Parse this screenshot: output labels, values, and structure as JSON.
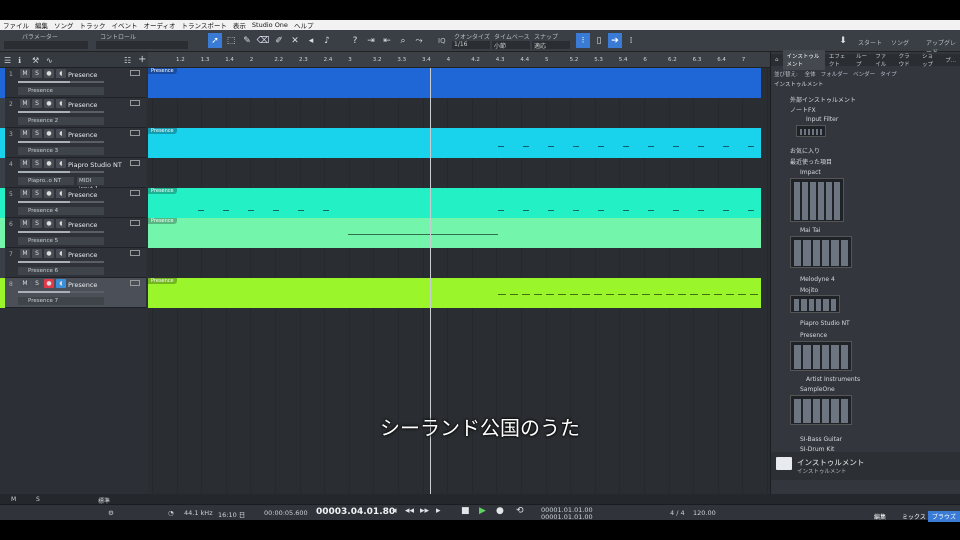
{
  "menu": [
    "ファイル",
    "編集",
    "ソング",
    "トラック",
    "イベント",
    "オーディオ",
    "トランスポート",
    "表示",
    "Studio One",
    "ヘルプ"
  ],
  "toolbar": {
    "param_label": "パラメーター",
    "control_label": "コントロール",
    "iq_label": "IQ",
    "quantize_label": "クオンタイズ",
    "quantize_value": "1/16",
    "timebase_label": "タイムベース",
    "timebase_value": "小節",
    "snap_label": "スナップ",
    "snap_value": "適応",
    "start_label": "スタート",
    "song_label": "ソング",
    "upgrade_label": "アップグレード"
  },
  "ruler": [
    "1.2",
    "1.3",
    "1.4",
    "2",
    "2.2",
    "2.3",
    "2.4",
    "3",
    "3.2",
    "3.3",
    "3.4",
    "4",
    "4.2",
    "4.3",
    "4.4",
    "5",
    "5.2",
    "5.3",
    "5.4",
    "6",
    "6.2",
    "6.3",
    "6.4",
    "7"
  ],
  "tracks": [
    {
      "num": "1",
      "name": "Presence",
      "instrument": "Presence",
      "color": "#1f66d6",
      "clip": true,
      "armed": false
    },
    {
      "num": "2",
      "name": "Presence",
      "instrument": "Presence 2",
      "color": "#2a2d31",
      "clip": false,
      "armed": false
    },
    {
      "num": "3",
      "name": "Presence",
      "instrument": "Presence 3",
      "color": "#19d3ec",
      "clip": true,
      "armed": false
    },
    {
      "num": "4",
      "name": "Piapro Studio NT",
      "instrument": "Piapro..o NT",
      "instrument2": "MIDI input 1",
      "color": "#2a2d31",
      "clip": false,
      "armed": false
    },
    {
      "num": "5",
      "name": "Presence",
      "instrument": "Presence 4",
      "color": "#24f0c6",
      "clip": true,
      "armed": false
    },
    {
      "num": "6",
      "name": "Presence",
      "instrument": "Presence 5",
      "color": "#74f5ac",
      "clip": true,
      "armed": false
    },
    {
      "num": "7",
      "name": "Presence",
      "instrument": "Presence 6",
      "color": "#2a2d31",
      "clip": false,
      "armed": false
    },
    {
      "num": "8",
      "name": "Presence",
      "instrument": "Presence 7",
      "color": "#9af52a",
      "clip": true,
      "armed": true
    }
  ],
  "track_btns": {
    "mute": "M",
    "solo": "S"
  },
  "clip_label": "Presence",
  "browser": {
    "tabs": [
      "インストゥルメント",
      "エフェクト",
      "ループ",
      "ファイル",
      "クラウド",
      "ショップ",
      "プ..."
    ],
    "sortby": "並び替え:",
    "sort_opts": [
      "全体",
      "フォルダー",
      "ベンダー",
      "タイプ"
    ],
    "crumb": "インストゥルメント",
    "items": [
      "外部インストゥルメント",
      "ノートFX",
      "Input Filter",
      "お気に入り",
      "最近使った項目",
      "Impact",
      "Mai Tai",
      "Melodyne 4",
      "Mojito",
      "Piapro Studio NT",
      "Presence",
      "Artist Instruments",
      "SampleOne",
      "SI-Bass Guitar",
      "SI-Drum Kit"
    ],
    "footer_title": "インストゥルメント",
    "footer_sub": "インストゥルメント"
  },
  "status": {
    "m": "M",
    "s": "S",
    "std": "標準"
  },
  "transport": {
    "samplerate": "44.1 kHz",
    "rec_time": "16:10 日",
    "time": "00:00:05.600",
    "position": "00003.04.01.80",
    "loop_start": "00001.01.01.00",
    "loop_end": "00001.01.01.00",
    "signature": "4 / 4",
    "tempo": "120.00"
  },
  "bottom_tabs": [
    "編集",
    "ミックス",
    "ブラウズ"
  ],
  "subtitle": "シーランド公国のうた"
}
